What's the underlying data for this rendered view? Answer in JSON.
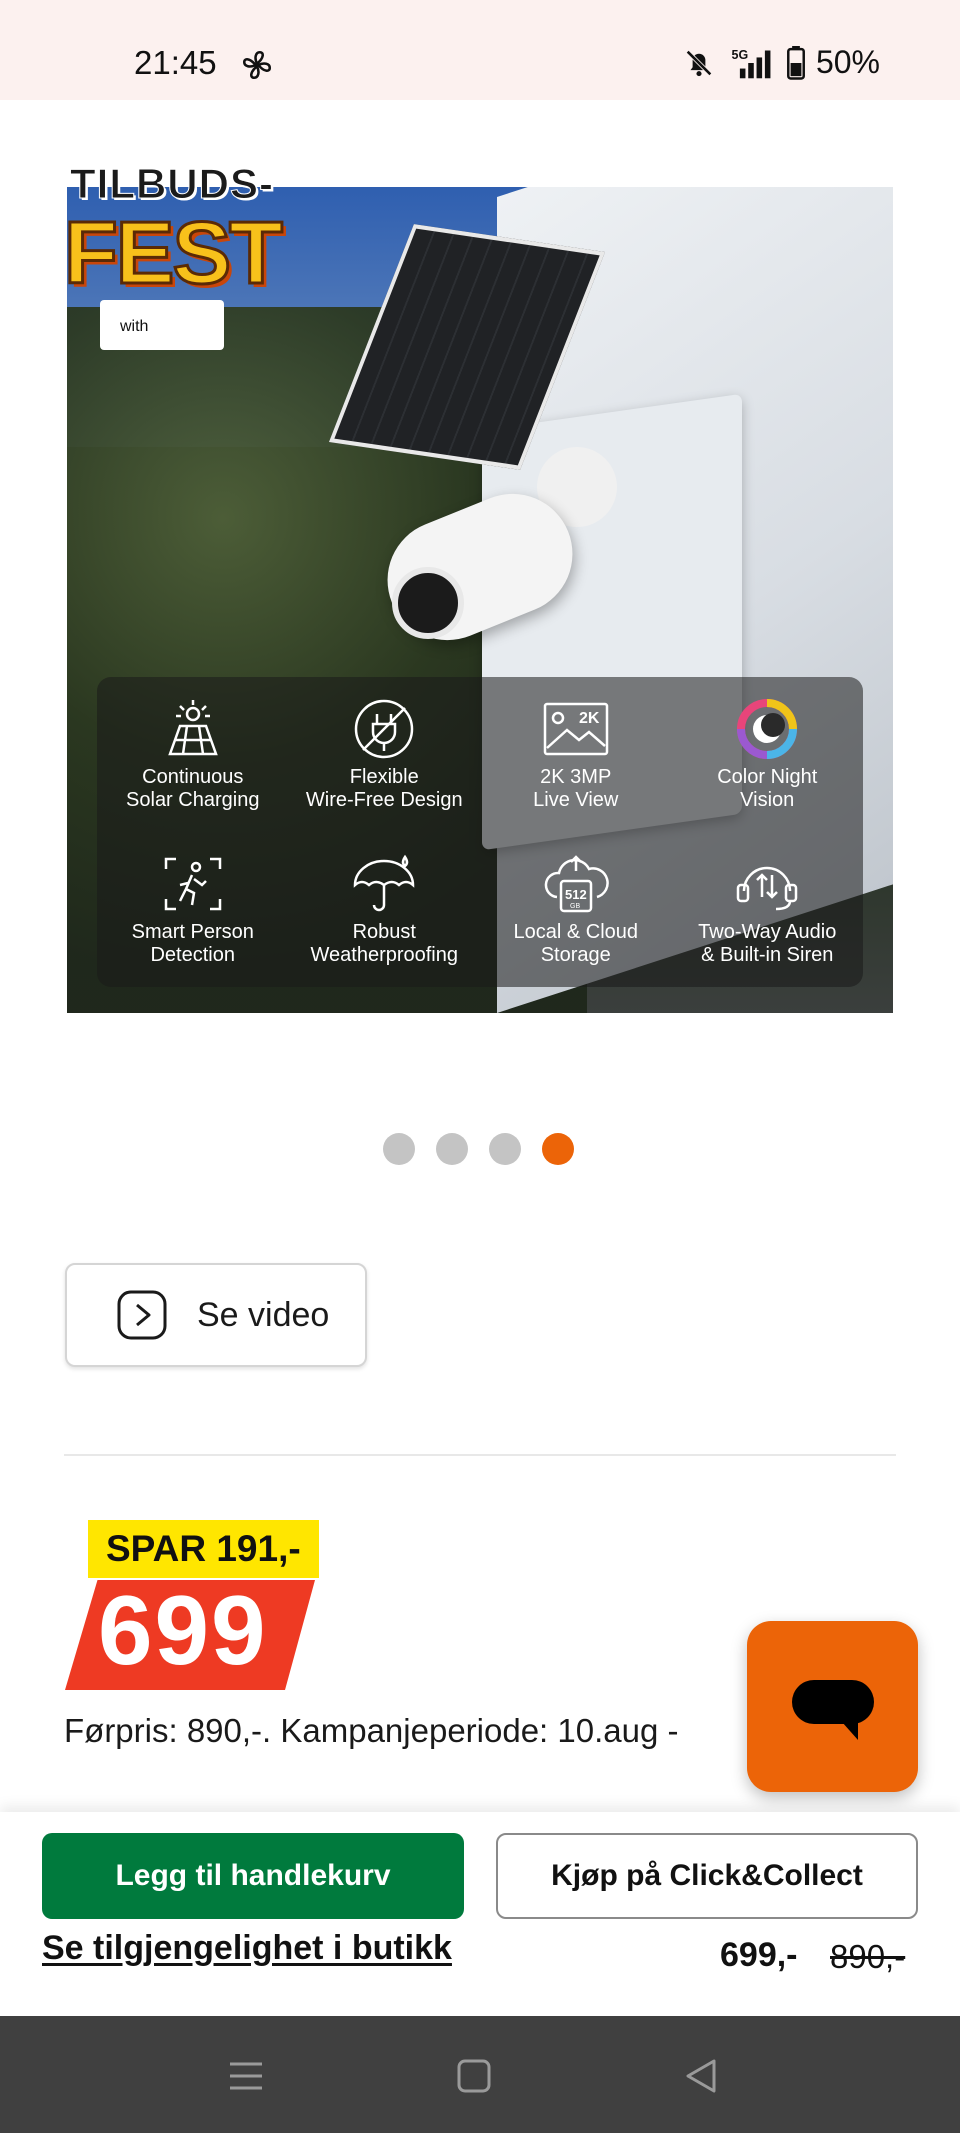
{
  "status": {
    "time": "21:45",
    "battery": "50%",
    "icons": [
      "fan-icon",
      "mute-bell-icon",
      "5g-signal-icon",
      "battery-icon"
    ]
  },
  "gallery": {
    "promo_top": "TILBUDS-",
    "promo_main": "FEST",
    "alexa_text": "with",
    "features": [
      {
        "icon": "solar-panel-icon",
        "label": "Continuous\nSolar Charging"
      },
      {
        "icon": "no-plug-icon",
        "label": "Flexible\nWire-Free Design"
      },
      {
        "icon": "2k-image-icon",
        "label": "2K 3MP\nLive View"
      },
      {
        "icon": "color-wheel-icon",
        "label": "Color Night\nVision"
      },
      {
        "icon": "person-detect-icon",
        "label": "Smart Person\nDetection"
      },
      {
        "icon": "umbrella-icon",
        "label": "Robust\nWeatherproofing"
      },
      {
        "icon": "cloud-storage-icon",
        "label": "Local & Cloud\nStorage"
      },
      {
        "icon": "two-way-audio-icon",
        "label": "Two-Way Audio\n& Built-in Siren"
      }
    ],
    "dots_total": 4,
    "active_dot": 4
  },
  "video": {
    "label": "Se video"
  },
  "price": {
    "save_label": "SPAR 191,-",
    "price": "699",
    "previous_price_text": "Førpris: 890,-. Kampanjeperiode: 10.aug -"
  },
  "actions": {
    "add_to_cart": "Legg til handlekurv",
    "click_collect": "Kjøp på Click&Collect",
    "availability": "Se tilgjengelighet i butikk",
    "price": "699,-",
    "old_price": "890,-"
  },
  "colors": {
    "accent_orange": "#ec6408",
    "cart_green": "#007a3d",
    "price_red": "#ee3a23",
    "save_yellow": "#ffe600"
  }
}
